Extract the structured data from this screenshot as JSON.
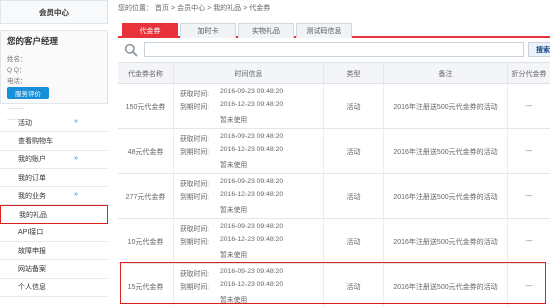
{
  "sidebar": {
    "header": "会员中心",
    "manager": {
      "title": "您的客户经理",
      "name_label": "姓名：",
      "qq_label": "Q Q：",
      "phone_label": "电话：",
      "eval_button": "服务评价"
    },
    "menu": [
      {
        "label": "活动",
        "chevron": "»"
      },
      {
        "label": "查看购物车",
        "chevron": ""
      },
      {
        "label": "我的账户",
        "chevron": "»"
      },
      {
        "label": "我的订单",
        "chevron": ""
      },
      {
        "label": "我的业务",
        "chevron": "»"
      },
      {
        "label": "我的礼品",
        "chevron": ""
      },
      {
        "label": "API接口",
        "chevron": ""
      },
      {
        "label": "故障申报",
        "chevron": ""
      },
      {
        "label": "网站备案",
        "chevron": ""
      },
      {
        "label": "个人信息",
        "chevron": ""
      }
    ]
  },
  "breadcrumb": {
    "prefix": "您的位置：",
    "items": [
      "首页",
      "会员中心",
      "我的礼品",
      "代金券"
    ],
    "sep": ">"
  },
  "tabs": [
    "代金券",
    "加时卡",
    "实物礼品",
    "测试码信息"
  ],
  "search": {
    "button": "搜索",
    "placeholder": ""
  },
  "table": {
    "headers": [
      "代金券名称",
      "时间信息",
      "类型",
      "备注",
      "折分代金券"
    ],
    "get_label": "获取时间:",
    "expire_label": "到期时间:",
    "rows": [
      {
        "name": "150元代金券",
        "get": "2016-09-23 09:48:20",
        "expire": "2016-12-23 09:48:20",
        "status": "暂未使用",
        "type": "活动",
        "note": "2016年注册送500元代金券的活动",
        "action": "---"
      },
      {
        "name": "48元代金券",
        "get": "2016-09-23 09:48:20",
        "expire": "2016-12-23 09:48:20",
        "status": "暂未使用",
        "type": "活动",
        "note": "2016年注册送500元代金券的活动",
        "action": "---"
      },
      {
        "name": "277元代金券",
        "get": "2016-09-23 09:48:20",
        "expire": "2016-12-23 09:48:20",
        "status": "暂未使用",
        "type": "活动",
        "note": "2016年注册送500元代金券的活动",
        "action": "---"
      },
      {
        "name": "10元代金券",
        "get": "2016-09-23 09:48:20",
        "expire": "2016-12-23 09:48:20",
        "status": "暂未使用",
        "type": "活动",
        "note": "2016年注册送500元代金券的活动",
        "action": "---"
      },
      {
        "name": "15元代金券",
        "get": "2016-09-23 09:48:20",
        "expire": "2016-12-23 09:48:20",
        "status": "暂未使用",
        "type": "活动",
        "note": "2016年注册送500元代金券的活动",
        "action": "---"
      }
    ]
  }
}
